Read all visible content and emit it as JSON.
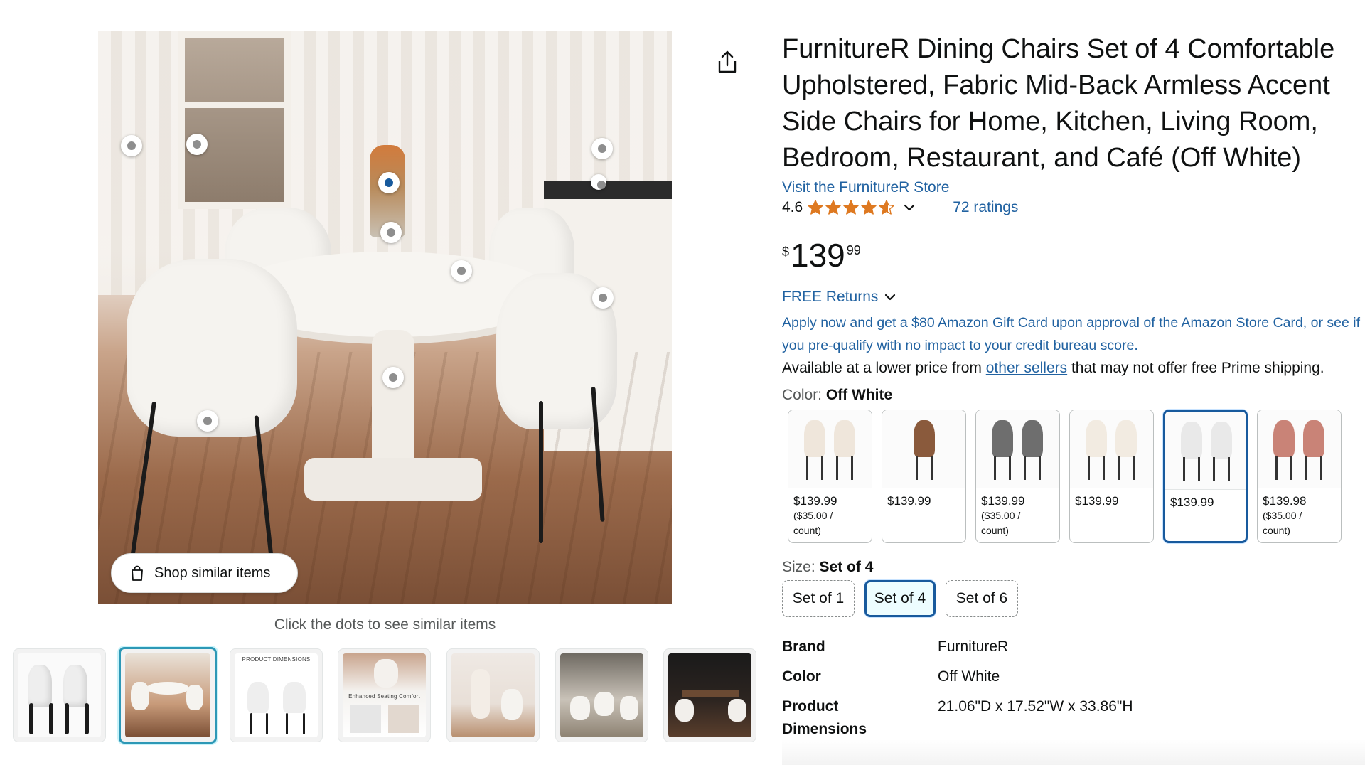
{
  "gallery": {
    "shop_similar_label": "Shop similar items",
    "hint": "Click the dots to see similar items",
    "dims_thumb_label": "PRODUCT DIMENSIONS",
    "comfort_thumb_label": "Enhanced Seating Comfort"
  },
  "product": {
    "title": "FurnitureR Dining Chairs Set of 4 Comfortable Upholstered, Fabric Mid-Back Armless Accent Side Chairs for Home, Kitchen, Living Room, Bedroom, Restaurant, and Café (Off White)",
    "store_link": "Visit the FurnitureR Store",
    "rating": "4.6",
    "rating_value": 4.6,
    "ratings_count": "72 ratings",
    "price_symbol": "$",
    "price_whole": "139",
    "price_fraction": "99",
    "free_returns": "FREE Returns",
    "apply_offer": "Apply now and get a $80 Amazon Gift Card upon approval of the Amazon Store Card, or see if you pre-qualify with no impact to your credit bureau score.",
    "availability_prefix": "Available at a lower price from ",
    "availability_link": "other sellers",
    "availability_suffix": " that may not offer free Prime shipping."
  },
  "color": {
    "label": "Color: ",
    "selected": "Off White",
    "options": [
      {
        "price": "$139.99",
        "unit": "($35.00 / count)",
        "chair_color": "#efe6db"
      },
      {
        "price": "$139.99",
        "unit": "",
        "chair_color": "#8a5a3c"
      },
      {
        "price": "$139.99",
        "unit": "($35.00 / count)",
        "chair_color": "#6e6e6e"
      },
      {
        "price": "$139.99",
        "unit": "",
        "chair_color": "#f2ebe1"
      },
      {
        "price": "$139.99",
        "unit": "",
        "chair_color": "#e9e9e9"
      },
      {
        "price": "$139.98",
        "unit": "($35.00 / count)",
        "chair_color": "#c98377"
      }
    ]
  },
  "size": {
    "label": "Size: ",
    "selected": "Set of 4",
    "options": [
      "Set of 1",
      "Set of 4",
      "Set of 6"
    ]
  },
  "specs": [
    {
      "key": "Brand",
      "value": "FurnitureR"
    },
    {
      "key": "Color",
      "value": "Off White"
    },
    {
      "key": "Product Dimensions",
      "value": "21.06\"D x 17.52\"W x 33.86\"H"
    }
  ],
  "colors": {
    "link": "#2162a1",
    "star": "#de7921",
    "selected_border": "#185a9d",
    "thumb_selected": "#2d98b6"
  },
  "icons": [
    "share-icon",
    "star-icon",
    "chevron-down-icon",
    "shopping-bag-icon",
    "hotspot-dot-icon"
  ]
}
